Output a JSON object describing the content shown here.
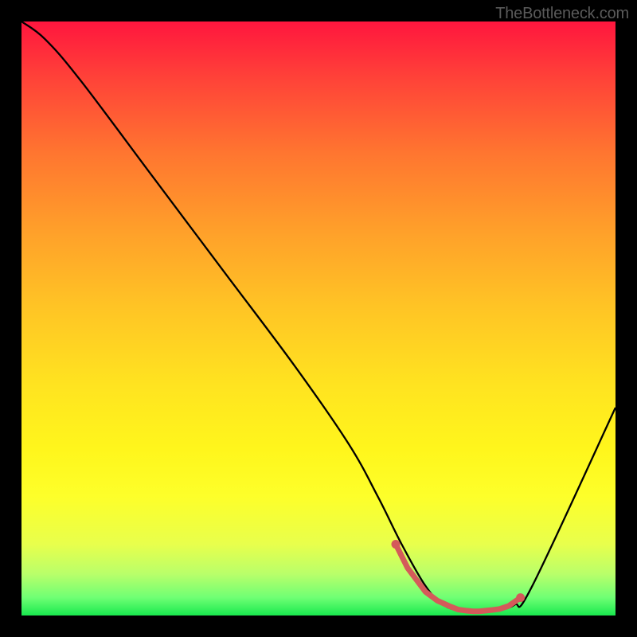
{
  "watermark": "TheBottleneck.com",
  "colors": {
    "frame": "#000000",
    "curve_stroke": "#000000",
    "marker_stroke": "#d45a5a",
    "marker_fill": "#d45a5a"
  },
  "chart_data": {
    "type": "line",
    "title": "",
    "xlabel": "",
    "ylabel": "",
    "xlim": [
      0,
      100
    ],
    "ylim": [
      0,
      100
    ],
    "grid": false,
    "series": [
      {
        "name": "bottleneck-curve",
        "x": [
          0,
          4,
          10,
          22,
          34,
          46,
          55,
          60,
          64,
          68,
          71,
          74,
          77,
          80,
          83,
          86,
          100
        ],
        "values": [
          100,
          97,
          90,
          74,
          58,
          42,
          29,
          20,
          12,
          5,
          1.8,
          0.8,
          0.7,
          0.9,
          1.8,
          5,
          35
        ]
      }
    ],
    "markers": {
      "name": "optimal-range",
      "x": [
        63,
        65,
        68,
        70,
        72,
        73.5,
        75,
        76,
        77,
        78,
        79,
        80.5,
        82,
        84
      ],
      "values": [
        12,
        8,
        4,
        2.5,
        1.6,
        1.0,
        0.8,
        0.7,
        0.7,
        0.8,
        0.9,
        1.1,
        1.6,
        3
      ]
    }
  }
}
